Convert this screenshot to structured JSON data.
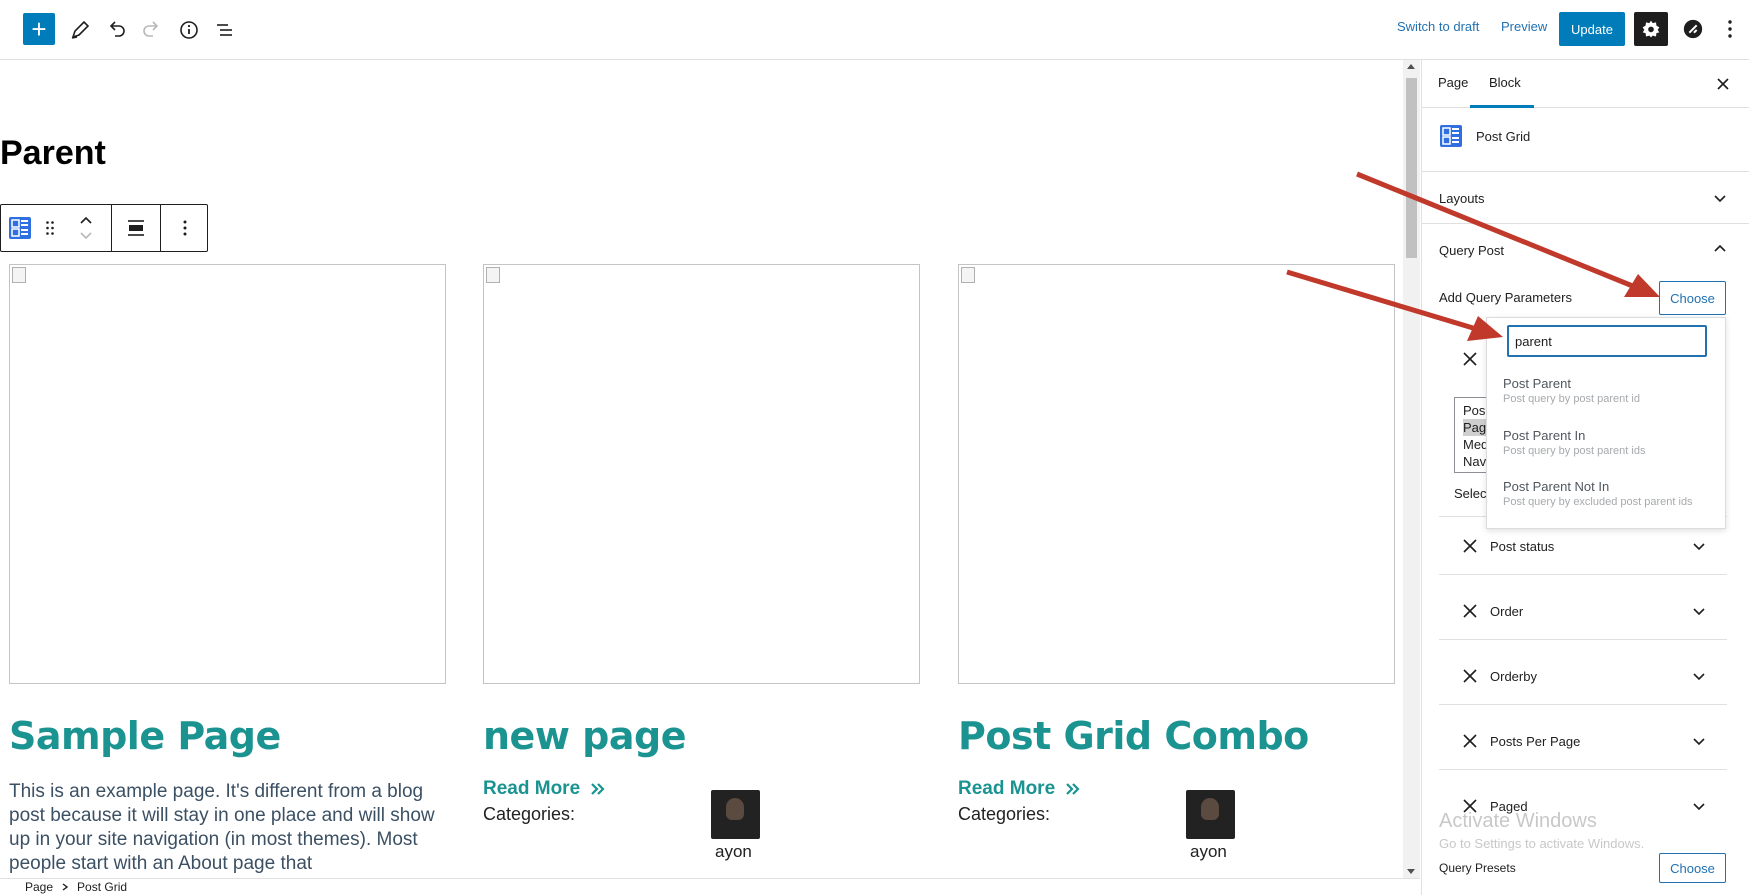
{
  "topbar": {
    "inserter_label": "+",
    "switch_to_draft": "Switch to draft",
    "preview": "Preview",
    "update": "Update"
  },
  "canvas": {
    "page_title": "Parent",
    "cards": [
      {
        "title": "Sample Page",
        "excerpt": "This is an example page. It's different from a blog post because it will stay in one place and will show up in your site navigation (in most themes). Most people start with an About page that"
      },
      {
        "title": "new page",
        "read_more": "Read More",
        "categories": "Categories:",
        "author": "ayon"
      },
      {
        "title": "Post Grid Combo",
        "read_more": "Read More",
        "categories": "Categories:",
        "author": "ayon"
      }
    ]
  },
  "breadcrumb": {
    "items": [
      "Page",
      "Post Grid"
    ]
  },
  "sidebar": {
    "tabs": [
      "Page",
      "Block"
    ],
    "active_tab": "Block",
    "block_name": "Post Grid",
    "panels": {
      "layouts": "Layouts",
      "query_post": "Query Post",
      "add_query_parameters": "Add Query Parameters",
      "choose": "Choose",
      "post_types_visible": [
        "Pos",
        "Pag",
        "Med",
        "Nav"
      ],
      "select_label": "Selec",
      "params": [
        "Post status",
        "Order",
        "Orderby",
        "Posts Per Page",
        "Paged"
      ],
      "query_presets": "Query Presets",
      "choose_presets": "Choose"
    },
    "dropdown": {
      "search_value": "parent",
      "items": [
        {
          "title": "Post Parent",
          "desc": "Post query by post parent id"
        },
        {
          "title": "Post Parent In",
          "desc": "Post query by post parent ids"
        },
        {
          "title": "Post Parent Not In",
          "desc": "Post query by excluded post parent ids"
        }
      ]
    }
  },
  "watermark": {
    "line1": "Activate Windows",
    "line2": "Go to Settings to activate Windows."
  },
  "colors": {
    "accent": "#007cba",
    "title_teal": "#1a9391",
    "arrow": "#c0392b"
  }
}
